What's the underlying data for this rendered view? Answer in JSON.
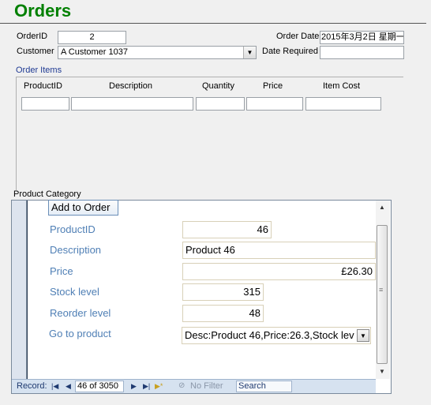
{
  "form_title": "Orders",
  "order": {
    "order_id_label": "OrderID",
    "order_id_value": "2",
    "customer_label": "Customer",
    "customer_value": "A Customer 1037",
    "order_date_label": "Order Date",
    "order_date_value": "2015年3月2日 星期一",
    "date_required_label": "Date Required",
    "date_required_value": ""
  },
  "order_items": {
    "label": "Order Items",
    "columns": [
      "ProductID",
      "Description",
      "Quantity",
      "Price",
      "Item Cost"
    ]
  },
  "product_category": {
    "label": "Product Category",
    "add_button": "Add to Order",
    "fields": {
      "productid_label": "ProductID",
      "productid_value": "46",
      "description_label": "Description",
      "description_value": "Product 46",
      "price_label": "Price",
      "price_value": "£26.30",
      "stock_label": "Stock level",
      "stock_value": "315",
      "reorder_label": "Reorder level",
      "reorder_value": "48",
      "goto_label": "Go to product",
      "goto_value": "Desc:Product 46,Price:26.3,Stock lev"
    }
  },
  "navigation": {
    "record_label": "Record:",
    "record_position": "46 of 3050",
    "no_filter": "No Filter",
    "search_placeholder": "Search"
  },
  "icons": {
    "dropdown": "chevron-down-icon",
    "first": "first-record-icon",
    "prev": "prev-record-icon",
    "next": "next-record-icon",
    "last": "last-record-icon",
    "new": "new-record-icon",
    "filter": "filter-icon",
    "scroll_up": "scroll-up-icon",
    "scroll_down": "scroll-down-icon"
  },
  "colors": {
    "title": "#008000",
    "subform_labels": "#4f7fb5"
  }
}
